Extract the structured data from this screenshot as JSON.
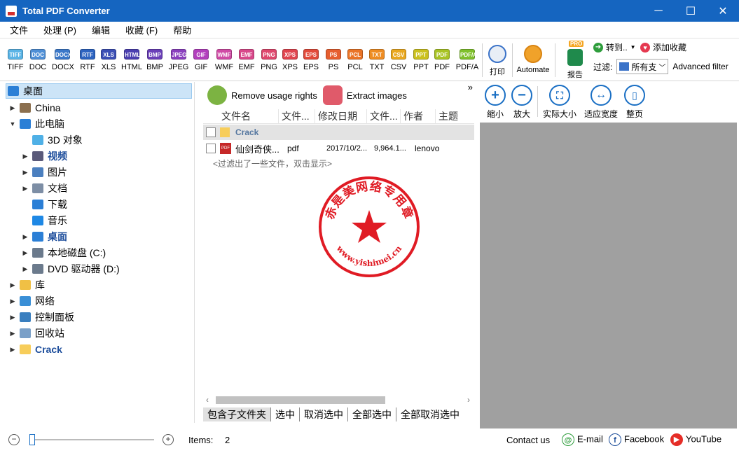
{
  "app": {
    "title": "Total PDF Converter"
  },
  "window_controls": {
    "minimize": "─",
    "maximize": "☐",
    "close": "✕"
  },
  "menu": [
    "文件",
    "处理 (P)",
    "编辑",
    "收藏 (F)",
    "帮助"
  ],
  "formats": [
    {
      "label": "TIFF",
      "color": "#5ab4e6"
    },
    {
      "label": "DOC",
      "color": "#4f8fd6"
    },
    {
      "label": "DOCX",
      "color": "#3b78c9"
    },
    {
      "label": "RTF",
      "color": "#2d63c0"
    },
    {
      "label": "XLS",
      "color": "#3c4fb5"
    },
    {
      "label": "HTML",
      "color": "#4a3fb0"
    },
    {
      "label": "BMP",
      "color": "#6a3fb8"
    },
    {
      "label": "JPEG",
      "color": "#8a3fbe"
    },
    {
      "label": "GIF",
      "color": "#b23fbd"
    },
    {
      "label": "WMF",
      "color": "#d04aa5"
    },
    {
      "label": "EMF",
      "color": "#d8488a"
    },
    {
      "label": "PNG",
      "color": "#de466c"
    },
    {
      "label": "XPS",
      "color": "#e0444e"
    },
    {
      "label": "EPS",
      "color": "#e24a3a"
    },
    {
      "label": "PS",
      "color": "#e65e2f"
    },
    {
      "label": "PCL",
      "color": "#ea7427"
    },
    {
      "label": "TXT",
      "color": "#ee8c22"
    },
    {
      "label": "CSV",
      "color": "#e9a820"
    },
    {
      "label": "PPT",
      "color": "#cbc11e"
    },
    {
      "label": "PDF",
      "color": "#a8c324"
    },
    {
      "label": "PDF/A",
      "color": "#7fc02c"
    }
  ],
  "toolbar": {
    "print": "打印",
    "automate": "Automate",
    "report": "报告",
    "report_badge": "PRO",
    "convert_to": "转到..",
    "add_favorite": "添加收藏",
    "filter_label": "过滤:",
    "filter_value": "所有支",
    "advanced_filter": "Advanced filter"
  },
  "tree": {
    "root": "桌面",
    "items": [
      {
        "label": "China",
        "level": 1,
        "expand": "▶"
      },
      {
        "label": "此电脑",
        "level": 1,
        "expand": "▼"
      },
      {
        "label": "3D 对象",
        "level": 2,
        "expand": ""
      },
      {
        "label": "视频",
        "level": 2,
        "expand": "▶",
        "bold": true
      },
      {
        "label": "图片",
        "level": 2,
        "expand": "▶"
      },
      {
        "label": "文档",
        "level": 2,
        "expand": "▶"
      },
      {
        "label": "下载",
        "level": 2,
        "expand": ""
      },
      {
        "label": "音乐",
        "level": 2,
        "expand": ""
      },
      {
        "label": "桌面",
        "level": 2,
        "expand": "▶",
        "bold": true
      },
      {
        "label": "本地磁盘 (C:)",
        "level": 2,
        "expand": "▶"
      },
      {
        "label": "DVD 驱动器 (D:)",
        "level": 2,
        "expand": "▶"
      },
      {
        "label": "库",
        "level": 1,
        "expand": "▶"
      },
      {
        "label": "网络",
        "level": 1,
        "expand": "▶"
      },
      {
        "label": "控制面板",
        "level": 1,
        "expand": "▶"
      },
      {
        "label": "回收站",
        "level": 1,
        "expand": "▶"
      },
      {
        "label": "Crack",
        "level": 1,
        "expand": "▶",
        "bold": true
      }
    ]
  },
  "actions": {
    "remove_rights": "Remove usage rights",
    "extract_images": "Extract images",
    "more": "»"
  },
  "columns": [
    "文件名",
    "文件...",
    "修改日期",
    "文件...",
    "作者",
    "主题"
  ],
  "files": {
    "folder": "Crack",
    "rows": [
      {
        "name": "仙剑奇侠...",
        "type": "pdf",
        "date": "2017/10/2...",
        "size": "9,964.1...",
        "author": "lenovo"
      }
    ],
    "hint": "<过滤出了一些文件，双击显示>"
  },
  "bottom_buttons": [
    "包含子文件夹",
    "选中",
    "取消选中",
    "全部选中",
    "全部取消选中"
  ],
  "zoom": {
    "zoom_out": "缩小",
    "zoom_in": "放大",
    "actual_size": "实际大小",
    "fit_width": "适应宽度",
    "full_page": "整页"
  },
  "stamp": {
    "top_text": "赤是美网络专用章",
    "bottom_text": "www.yishimei.cn"
  },
  "status": {
    "items_label": "Items:",
    "items_count": "2",
    "contact": "Contact us",
    "email": "E-mail",
    "facebook": "Facebook",
    "youtube": "YouTube"
  }
}
